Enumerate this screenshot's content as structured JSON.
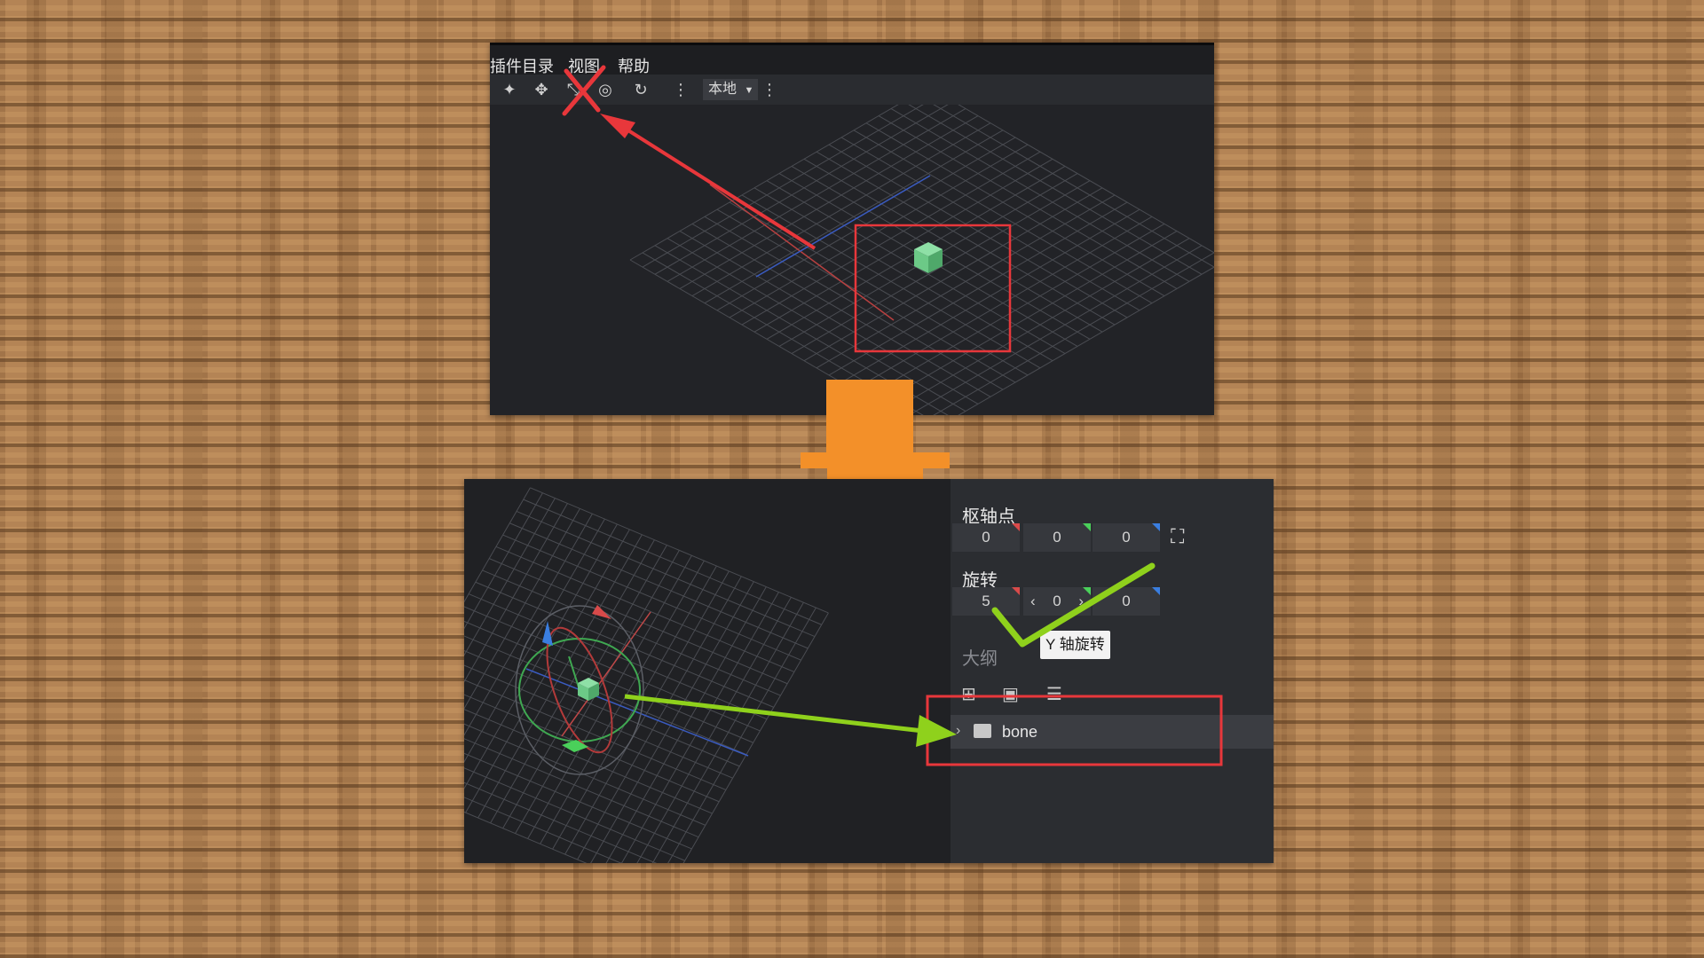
{
  "top_window": {
    "menu": [
      "插件目录",
      "视图",
      "帮助"
    ],
    "toolbar_icons": [
      "transform-icon",
      "move-icon",
      "resize-icon",
      "pivot-icon",
      "rotate-icon",
      "more-icon"
    ],
    "space_select": "本地"
  },
  "bottom_window": {
    "pivot": {
      "label": "枢轴点",
      "values": [
        "0",
        "0",
        "0"
      ]
    },
    "rotation": {
      "label": "旋转",
      "values": [
        "5",
        "0",
        "0"
      ]
    },
    "tooltip": "Y 轴旋转",
    "outline": {
      "label": "大纲",
      "items": [
        {
          "name": "bone"
        }
      ]
    }
  },
  "colors": {
    "x_axis": "#d84a4a",
    "y_axis": "#4ad05a",
    "z_axis": "#3a7ee0",
    "annotation_red": "#e8373b",
    "annotation_green": "#8fd11c",
    "arrow_orange": "#f39029"
  }
}
